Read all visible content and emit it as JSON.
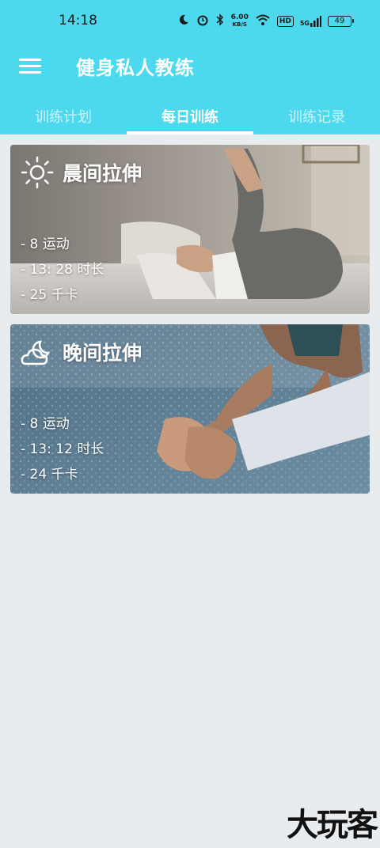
{
  "status_bar": {
    "time": "14:18",
    "net_speed_value": "6.00",
    "net_speed_unit": "KB/S",
    "hd": "HD",
    "signal": "5G",
    "battery": "49"
  },
  "toolbar": {
    "title": "健身私人教练"
  },
  "tabs": [
    {
      "label": "训练计划",
      "active": false
    },
    {
      "label": "每日训练",
      "active": true
    },
    {
      "label": "训练记录",
      "active": false
    }
  ],
  "cards": [
    {
      "title": "晨间拉伸",
      "icon": "sun-icon",
      "exercises": "- 8 运动",
      "duration": "- 13: 28 时长",
      "calories": "- 25 千卡"
    },
    {
      "title": "晚间拉伸",
      "icon": "moon-cloud-icon",
      "exercises": "- 8 运动",
      "duration": "- 13: 12 时长",
      "calories": "- 24 千卡"
    }
  ],
  "watermark": "大玩客",
  "colors": {
    "header": "#4dd9ed",
    "background": "#e9ecef"
  }
}
